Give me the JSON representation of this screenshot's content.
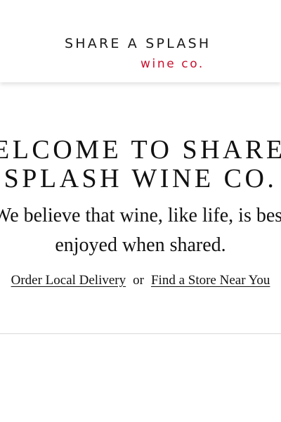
{
  "brand": {
    "logo_top": "SHARE A SPLASH",
    "logo_bottom": "wine co.",
    "accent_color": "#c8102e"
  },
  "hero": {
    "headline_line1": "WELCOME TO SHARE A",
    "headline_line2": "SPLASH WINE CO.",
    "tagline_line1": "We believe that wine, like life, is best",
    "tagline_line2": "enjoyed when shared.",
    "cta_delivery": "Order Local Delivery",
    "cta_separator": "or",
    "cta_store": "Find a Store Near You"
  }
}
